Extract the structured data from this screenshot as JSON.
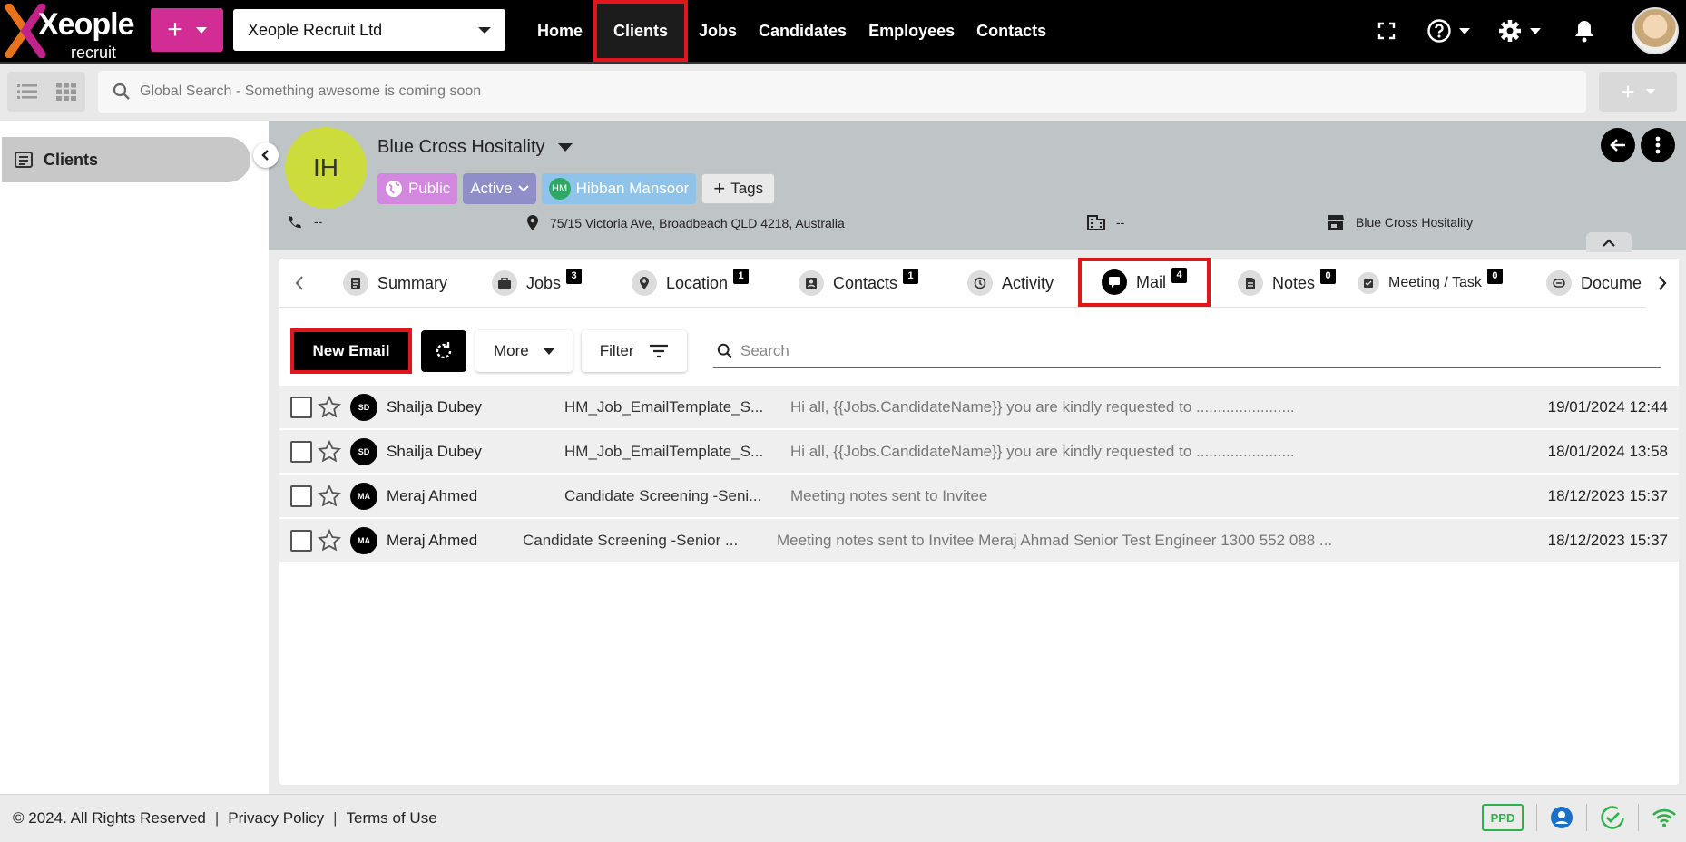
{
  "brand": {
    "logo_text": "Xeople",
    "logo_sub": "recruit"
  },
  "topnav": {
    "company": "Xeople Recruit Ltd",
    "links": [
      "Home",
      "Clients",
      "Jobs",
      "Candidates",
      "Employees",
      "Contacts"
    ],
    "active_link": "Clients"
  },
  "search": {
    "placeholder": "Global Search - Something awesome is coming soon"
  },
  "sidebar": {
    "items": [
      {
        "label": "Clients"
      }
    ]
  },
  "client": {
    "initials": "IH",
    "name": "Blue Cross Hositality",
    "chips": {
      "visibility": "Public",
      "status": "Active",
      "owner_initials": "HM",
      "owner": "Hibban Mansoor",
      "tags": "Tags"
    },
    "phone": "--",
    "address": "75/15 Victoria Ave, Broadbeach QLD 4218, Australia",
    "company_field": "--",
    "store": "Blue Cross Hositality"
  },
  "tabs": [
    {
      "label": "Summary",
      "icon": "summary-icon",
      "count": ""
    },
    {
      "label": "Jobs",
      "icon": "briefcase-icon",
      "count": "3"
    },
    {
      "label": "Location",
      "icon": "location-pin-icon",
      "count": "1"
    },
    {
      "label": "Contacts",
      "icon": "contact-card-icon",
      "count": "1"
    },
    {
      "label": "Activity",
      "icon": "history-icon",
      "count": ""
    },
    {
      "label": "Mail",
      "icon": "mail-icon",
      "count": "4"
    },
    {
      "label": "Notes",
      "icon": "notes-icon",
      "count": "0"
    },
    {
      "label": "Meeting / Task",
      "icon": "calendar-icon",
      "count": "0"
    },
    {
      "label": "Docume",
      "icon": "document-icon",
      "count": ""
    }
  ],
  "mail": {
    "new_email": "New Email",
    "more": "More",
    "filter": "Filter",
    "search_placeholder": "Search",
    "rows": [
      {
        "initials": "SD",
        "sender": "Shailja Dubey",
        "subject": "HM_Job_EmailTemplate_S...",
        "preview": "Hi all, {{Jobs.CandidateName}} you are kindly requested to .......................",
        "date": "19/01/2024 12:44"
      },
      {
        "initials": "SD",
        "sender": "Shailja Dubey",
        "subject": "HM_Job_EmailTemplate_S...",
        "preview": "Hi all, {{Jobs.CandidateName}} you are kindly requested to .......................",
        "date": "18/01/2024 13:58"
      },
      {
        "initials": "MA",
        "sender": "Meraj Ahmed",
        "subject": "Candidate Screening -Seni...",
        "preview": "Meeting notes sent to Invitee",
        "date": "18/12/2023 15:37"
      },
      {
        "initials": "MA",
        "sender": "Meraj Ahmed",
        "subject": "Candidate Screening -Senior ...",
        "preview": "Meeting notes sent to Invitee Meraj Ahmad Senior Test Engineer 1300 552 088  ...",
        "date": "18/12/2023 15:37"
      }
    ]
  },
  "footer": {
    "copyright": "© 2024. All Rights Reserved",
    "privacy": "Privacy Policy",
    "terms": "Terms of Use",
    "badge": "PPD"
  },
  "colors": {
    "brand_magenta": "#d12d95",
    "highlight_red": "#e0161b",
    "avatar_lime": "#ccdc3c"
  }
}
